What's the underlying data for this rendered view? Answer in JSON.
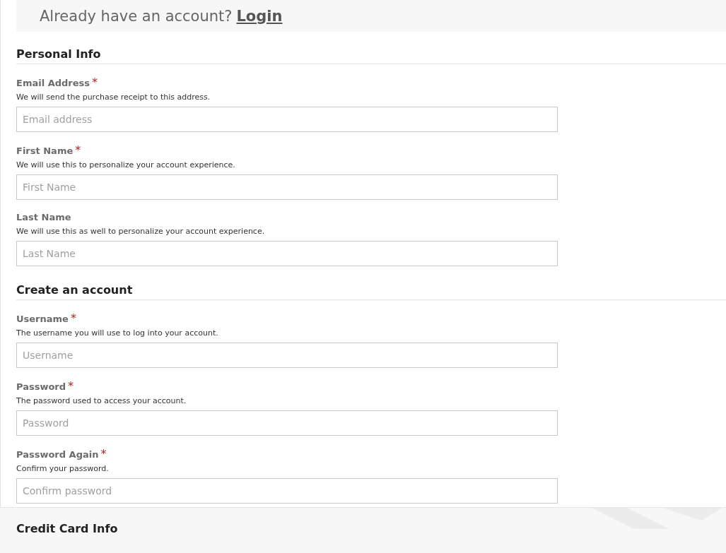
{
  "login_prompt": {
    "text": "Already have an account?",
    "link": "Login"
  },
  "sections": [
    {
      "title": "Personal Info",
      "fields": [
        {
          "label": "Email Address",
          "required": true,
          "help": "We will send the purchase receipt to this address.",
          "placeholder": "Email address"
        },
        {
          "label": "First Name",
          "required": true,
          "help": "We will use this to personalize your account experience.",
          "placeholder": "First Name"
        },
        {
          "label": "Last Name",
          "required": false,
          "help": "We will use this as well to personalize your account experience.",
          "placeholder": "Last Name"
        }
      ]
    },
    {
      "title": "Create an account",
      "fields": [
        {
          "label": "Username",
          "required": true,
          "help": "The username you will use to log into your account.",
          "placeholder": "Username"
        },
        {
          "label": "Password",
          "required": true,
          "help": "The password used to access your account.",
          "placeholder": "Password"
        },
        {
          "label": "Password Again",
          "required": true,
          "help": "Confirm your password.",
          "placeholder": "Confirm password"
        }
      ]
    }
  ],
  "next_section": {
    "title": "Credit Card Info"
  },
  "required_mark": "*"
}
